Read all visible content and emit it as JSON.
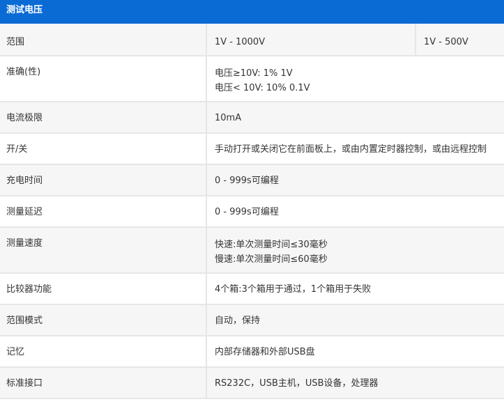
{
  "header": {
    "title": "测试电压"
  },
  "rows": [
    {
      "label": "范围",
      "values": [
        "1V - 1000V",
        "1V - 500V"
      ]
    },
    {
      "label": "准确(性)",
      "lines": [
        "电压≥10V: 1% 1V",
        "电压< 10V: 10% 0.1V"
      ]
    },
    {
      "label": "电流极限",
      "value": "10mA"
    },
    {
      "label": "开/关",
      "value": "手动打开或关闭它在前面板上，或由内置定时器控制，或由远程控制"
    },
    {
      "label": "充电时间",
      "value": "0 - 999s可编程"
    },
    {
      "label": "测量延迟",
      "value": "0 - 999s可编程"
    },
    {
      "label": "测量速度",
      "lines": [
        "快速:单次测量时间≤30毫秒",
        "慢速:单次测量时间≤60毫秒"
      ]
    },
    {
      "label": "比较器功能",
      "value": "4个箱:3个箱用于通过，1个箱用于失败"
    },
    {
      "label": "范围模式",
      "value": "自动，保持"
    },
    {
      "label": "记忆",
      "value": "内部存储器和外部USB盘"
    },
    {
      "label": "标准接口",
      "value": "RS232C，USB主机，USB设备，处理器"
    }
  ]
}
